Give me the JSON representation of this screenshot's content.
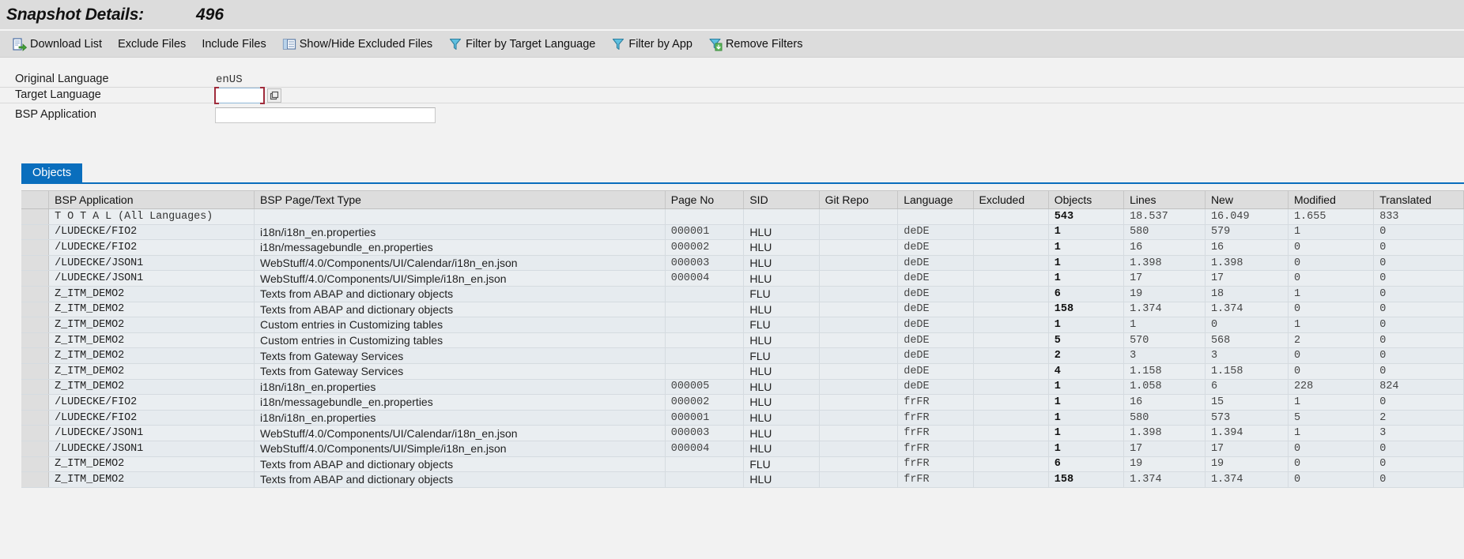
{
  "header": {
    "title": "Snapshot Details:",
    "value": "496"
  },
  "toolbar": {
    "items": [
      {
        "label": "Download List",
        "icon": "download-list-icon",
        "has_icon": true
      },
      {
        "label": "Exclude Files",
        "icon": "",
        "has_icon": false
      },
      {
        "label": "Include Files",
        "icon": "",
        "has_icon": false
      },
      {
        "label": "Show/Hide Excluded Files",
        "icon": "table-columns-icon",
        "has_icon": true
      },
      {
        "label": "Filter by Target Language",
        "icon": "filter-icon",
        "has_icon": true
      },
      {
        "label": "Filter by App",
        "icon": "filter-icon",
        "has_icon": true
      },
      {
        "label": "Remove Filters",
        "icon": "remove-filter-icon",
        "has_icon": true
      }
    ]
  },
  "form": {
    "original_language_label": "Original Language",
    "original_language_value": "enUS",
    "target_language_label": "Target Language",
    "target_language_value": "",
    "target_language_placeholder": "",
    "bsp_application_label": "BSP Application",
    "bsp_application_value": "",
    "bsp_application_placeholder": ""
  },
  "tabs": [
    {
      "label": "Objects",
      "active": true
    }
  ],
  "table": {
    "columns": [
      "BSP Application",
      "BSP Page/Text Type",
      "Page No",
      "SID",
      "Git Repo",
      "Language",
      "Excluded",
      "Objects",
      "Lines",
      "New",
      "Modified",
      "Translated"
    ],
    "rows": [
      {
        "app": "T O T A L  (All Languages)",
        "page": "",
        "pageno": "",
        "sid": "",
        "git": "",
        "lang": "",
        "excluded": "",
        "objects": "543",
        "lines": "18.537",
        "new": "16.049",
        "modified": "1.655",
        "translated": "833"
      },
      {
        "app": "/LUDECKE/FIO2",
        "page": "i18n/i18n_en.properties",
        "pageno": "000001",
        "sid": "HLU",
        "git": "",
        "lang": "deDE",
        "excluded": "",
        "objects": "1",
        "lines": "580",
        "new": "579",
        "modified": "1",
        "translated": "0"
      },
      {
        "app": "/LUDECKE/FIO2",
        "page": "i18n/messagebundle_en.properties",
        "pageno": "000002",
        "sid": "HLU",
        "git": "",
        "lang": "deDE",
        "excluded": "",
        "objects": "1",
        "lines": "16",
        "new": "16",
        "modified": "0",
        "translated": "0"
      },
      {
        "app": "/LUDECKE/JSON1",
        "page": "WebStuff/4.0/Components/UI/Calendar/i18n_en.json",
        "pageno": "000003",
        "sid": "HLU",
        "git": "",
        "lang": "deDE",
        "excluded": "",
        "objects": "1",
        "lines": "1.398",
        "new": "1.398",
        "modified": "0",
        "translated": "0"
      },
      {
        "app": "/LUDECKE/JSON1",
        "page": "WebStuff/4.0/Components/UI/Simple/i18n_en.json",
        "pageno": "000004",
        "sid": "HLU",
        "git": "",
        "lang": "deDE",
        "excluded": "",
        "objects": "1",
        "lines": "17",
        "new": "17",
        "modified": "0",
        "translated": "0"
      },
      {
        "app": "Z_ITM_DEMO2",
        "page": "Texts from ABAP and dictionary objects",
        "pageno": "",
        "sid": "FLU",
        "git": "",
        "lang": "deDE",
        "excluded": "",
        "objects": "6",
        "lines": "19",
        "new": "18",
        "modified": "1",
        "translated": "0"
      },
      {
        "app": "Z_ITM_DEMO2",
        "page": "Texts from ABAP and dictionary objects",
        "pageno": "",
        "sid": "HLU",
        "git": "",
        "lang": "deDE",
        "excluded": "",
        "objects": "158",
        "lines": "1.374",
        "new": "1.374",
        "modified": "0",
        "translated": "0"
      },
      {
        "app": "Z_ITM_DEMO2",
        "page": "Custom entries in Customizing tables",
        "pageno": "",
        "sid": "FLU",
        "git": "",
        "lang": "deDE",
        "excluded": "",
        "objects": "1",
        "lines": "1",
        "new": "0",
        "modified": "1",
        "translated": "0"
      },
      {
        "app": "Z_ITM_DEMO2",
        "page": "Custom entries in Customizing tables",
        "pageno": "",
        "sid": "HLU",
        "git": "",
        "lang": "deDE",
        "excluded": "",
        "objects": "5",
        "lines": "570",
        "new": "568",
        "modified": "2",
        "translated": "0"
      },
      {
        "app": "Z_ITM_DEMO2",
        "page": "Texts from Gateway Services",
        "pageno": "",
        "sid": "FLU",
        "git": "",
        "lang": "deDE",
        "excluded": "",
        "objects": "2",
        "lines": "3",
        "new": "3",
        "modified": "0",
        "translated": "0"
      },
      {
        "app": "Z_ITM_DEMO2",
        "page": "Texts from Gateway Services",
        "pageno": "",
        "sid": "HLU",
        "git": "",
        "lang": "deDE",
        "excluded": "",
        "objects": "4",
        "lines": "1.158",
        "new": "1.158",
        "modified": "0",
        "translated": "0"
      },
      {
        "app": "Z_ITM_DEMO2",
        "page": "i18n/i18n_en.properties",
        "pageno": "000005",
        "sid": "HLU",
        "git": "",
        "lang": "deDE",
        "excluded": "",
        "objects": "1",
        "lines": "1.058",
        "new": "6",
        "modified": "228",
        "translated": "824"
      },
      {
        "app": "/LUDECKE/FIO2",
        "page": "i18n/messagebundle_en.properties",
        "pageno": "000002",
        "sid": "HLU",
        "git": "",
        "lang": "frFR",
        "excluded": "",
        "objects": "1",
        "lines": "16",
        "new": "15",
        "modified": "1",
        "translated": "0"
      },
      {
        "app": "/LUDECKE/FIO2",
        "page": "i18n/i18n_en.properties",
        "pageno": "000001",
        "sid": "HLU",
        "git": "",
        "lang": "frFR",
        "excluded": "",
        "objects": "1",
        "lines": "580",
        "new": "573",
        "modified": "5",
        "translated": "2"
      },
      {
        "app": "/LUDECKE/JSON1",
        "page": "WebStuff/4.0/Components/UI/Calendar/i18n_en.json",
        "pageno": "000003",
        "sid": "HLU",
        "git": "",
        "lang": "frFR",
        "excluded": "",
        "objects": "1",
        "lines": "1.398",
        "new": "1.394",
        "modified": "1",
        "translated": "3"
      },
      {
        "app": "/LUDECKE/JSON1",
        "page": "WebStuff/4.0/Components/UI/Simple/i18n_en.json",
        "pageno": "000004",
        "sid": "HLU",
        "git": "",
        "lang": "frFR",
        "excluded": "",
        "objects": "1",
        "lines": "17",
        "new": "17",
        "modified": "0",
        "translated": "0"
      },
      {
        "app": "Z_ITM_DEMO2",
        "page": "Texts from ABAP and dictionary objects",
        "pageno": "",
        "sid": "FLU",
        "git": "",
        "lang": "frFR",
        "excluded": "",
        "objects": "6",
        "lines": "19",
        "new": "19",
        "modified": "0",
        "translated": "0"
      },
      {
        "app": "Z_ITM_DEMO2",
        "page": "Texts from ABAP and dictionary objects",
        "pageno": "",
        "sid": "HLU",
        "git": "",
        "lang": "frFR",
        "excluded": "",
        "objects": "158",
        "lines": "1.374",
        "new": "1.374",
        "modified": "0",
        "translated": "0"
      }
    ]
  },
  "colors": {
    "accent": "#0a6ebd",
    "toolbar_bg": "#dcdcdc",
    "focus_marker": "#a02c3c"
  }
}
